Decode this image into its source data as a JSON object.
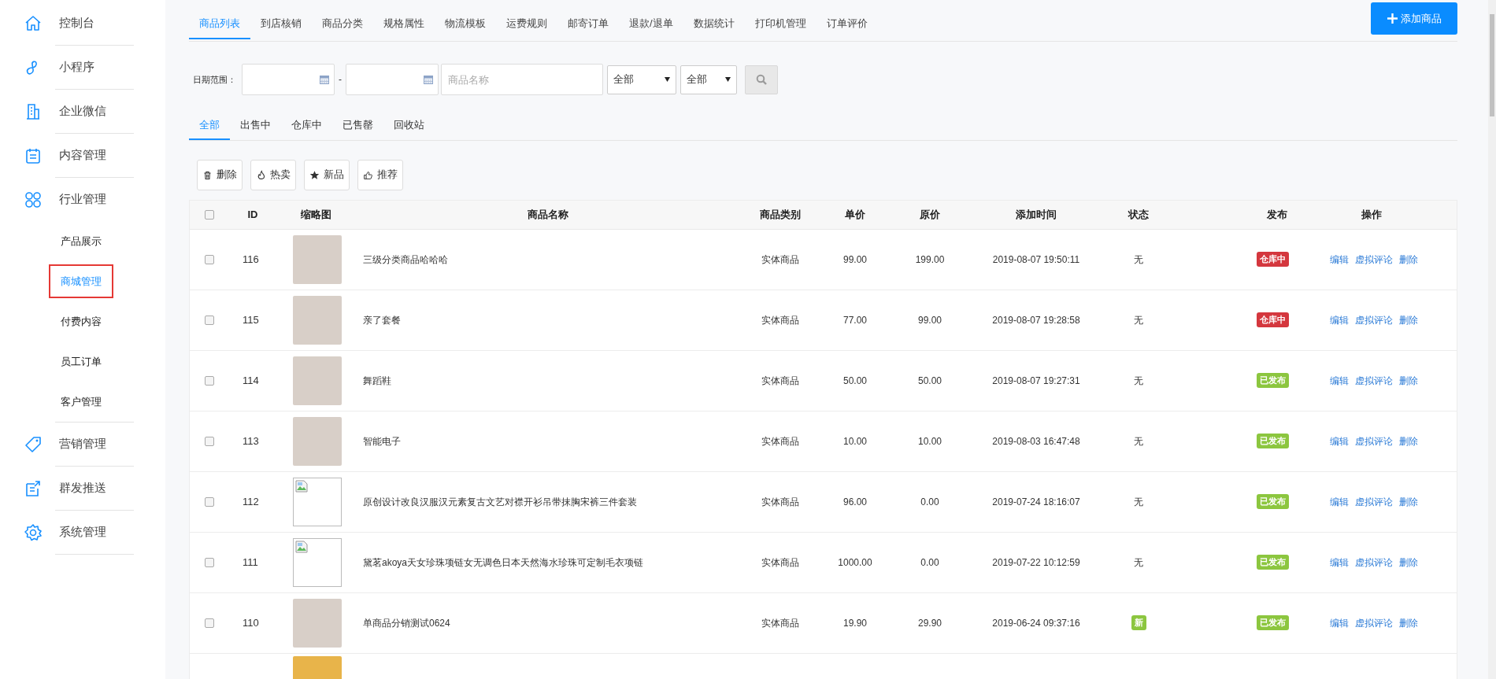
{
  "sidebar": {
    "items": [
      {
        "label": "控制台",
        "selected": false
      },
      {
        "label": "小程序",
        "selected": false
      },
      {
        "label": "企业微信",
        "selected": false
      },
      {
        "label": "内容管理",
        "selected": false
      },
      {
        "label": "行业管理",
        "selected": false,
        "children": [
          {
            "label": "产品展示",
            "selected": false
          },
          {
            "label": "商城管理",
            "selected": true
          },
          {
            "label": "付费内容",
            "selected": false
          },
          {
            "label": "员工订单",
            "selected": false
          },
          {
            "label": "客户管理",
            "selected": false
          }
        ]
      },
      {
        "label": "营销管理",
        "selected": false
      },
      {
        "label": "群发推送",
        "selected": false
      },
      {
        "label": "系统管理",
        "selected": false
      }
    ]
  },
  "tabs": [
    {
      "label": "商品列表",
      "selected": true
    },
    {
      "label": "到店核销",
      "selected": false
    },
    {
      "label": "商品分类",
      "selected": false
    },
    {
      "label": "规格属性",
      "selected": false
    },
    {
      "label": "物流模板",
      "selected": false
    },
    {
      "label": "运费规则",
      "selected": false
    },
    {
      "label": "邮寄订单",
      "selected": false
    },
    {
      "label": "退款/退单",
      "selected": false
    },
    {
      "label": "数据统计",
      "selected": false
    },
    {
      "label": "打印机管理",
      "selected": false
    },
    {
      "label": "订单评价",
      "selected": false
    }
  ],
  "add_button": "添加商品",
  "filters": {
    "date_label": "日期范围：",
    "date_separator": "-",
    "name_placeholder": "商品名称",
    "select_1": "全部",
    "select_2": "全部"
  },
  "sub_tabs": [
    {
      "label": "全部",
      "selected": true
    },
    {
      "label": "出售中",
      "selected": false
    },
    {
      "label": "仓库中",
      "selected": false
    },
    {
      "label": "已售罄",
      "selected": false
    },
    {
      "label": "回收站",
      "selected": false
    }
  ],
  "toolbar": [
    {
      "label": "删除"
    },
    {
      "label": "热卖"
    },
    {
      "label": "新品"
    },
    {
      "label": "推荐"
    }
  ],
  "table": {
    "select_all_checked": false,
    "columns": [
      "ID",
      "缩略图",
      "商品名称",
      "商品类别",
      "单价",
      "原价",
      "添加时间",
      "状态",
      "发布",
      "操作"
    ],
    "rows": [
      {
        "checked": false,
        "id": "116",
        "kind": "photo",
        "name": "三级分类商品哈哈哈",
        "category": "实体商品",
        "price": "99.00",
        "original": "199.00",
        "time": "2019-08-07 19:50:11",
        "status": {
          "kind": "text",
          "text": "无"
        },
        "publish": {
          "text": "仓库中",
          "color": "#d4373e"
        },
        "actions": [
          "编辑",
          "虚拟评论",
          "删除"
        ]
      },
      {
        "checked": false,
        "id": "115",
        "kind": "photo",
        "name": "亲了套餐",
        "category": "实体商品",
        "price": "77.00",
        "original": "99.00",
        "time": "2019-08-07 19:28:58",
        "status": {
          "kind": "text",
          "text": "无"
        },
        "publish": {
          "text": "仓库中",
          "color": "#d4373e"
        },
        "actions": [
          "编辑",
          "虚拟评论",
          "删除"
        ]
      },
      {
        "checked": false,
        "id": "114",
        "kind": "photo",
        "name": "舞蹈鞋",
        "category": "实体商品",
        "price": "50.00",
        "original": "50.00",
        "time": "2019-08-07 19:27:31",
        "status": {
          "kind": "text",
          "text": "无"
        },
        "publish": {
          "text": "已发布",
          "color": "#8cc63f"
        },
        "actions": [
          "编辑",
          "虚拟评论",
          "删除"
        ]
      },
      {
        "checked": false,
        "id": "113",
        "kind": "photo",
        "name": "智能电子",
        "category": "实体商品",
        "price": "10.00",
        "original": "10.00",
        "time": "2019-08-03 16:47:48",
        "status": {
          "kind": "text",
          "text": "无"
        },
        "publish": {
          "text": "已发布",
          "color": "#8cc63f"
        },
        "actions": [
          "编辑",
          "虚拟评论",
          "删除"
        ]
      },
      {
        "checked": false,
        "id": "112",
        "kind": "broken_image",
        "name": "原创设计改良汉服汉元素复古文艺对襟开衫吊带抹胸宋裤三件套装",
        "category": "实体商品",
        "price": "96.00",
        "original": "0.00",
        "time": "2019-07-24 18:16:07",
        "status": {
          "kind": "text",
          "text": "无"
        },
        "publish": {
          "text": "已发布",
          "color": "#8cc63f"
        },
        "actions": [
          "编辑",
          "虚拟评论",
          "删除"
        ]
      },
      {
        "checked": false,
        "id": "111",
        "kind": "broken_image",
        "name": "黛茗akoya天女珍珠项链女无调色日本天然海水珍珠可定制毛衣项链",
        "category": "实体商品",
        "price": "1000.00",
        "original": "0.00",
        "time": "2019-07-22 10:12:59",
        "status": {
          "kind": "text",
          "text": "无"
        },
        "publish": {
          "text": "已发布",
          "color": "#8cc63f"
        },
        "actions": [
          "编辑",
          "虚拟评论",
          "删除"
        ]
      },
      {
        "checked": false,
        "id": "110",
        "kind": "photo",
        "name": "单商品分销测试0624",
        "category": "实体商品",
        "price": "19.90",
        "original": "29.90",
        "time": "2019-06-24 09:37:16",
        "status": {
          "kind": "badge",
          "text": "新"
        },
        "publish": {
          "text": "已发布",
          "color": "#8cc63f"
        },
        "actions": [
          "编辑",
          "虚拟评论",
          "删除"
        ]
      }
    ]
  }
}
